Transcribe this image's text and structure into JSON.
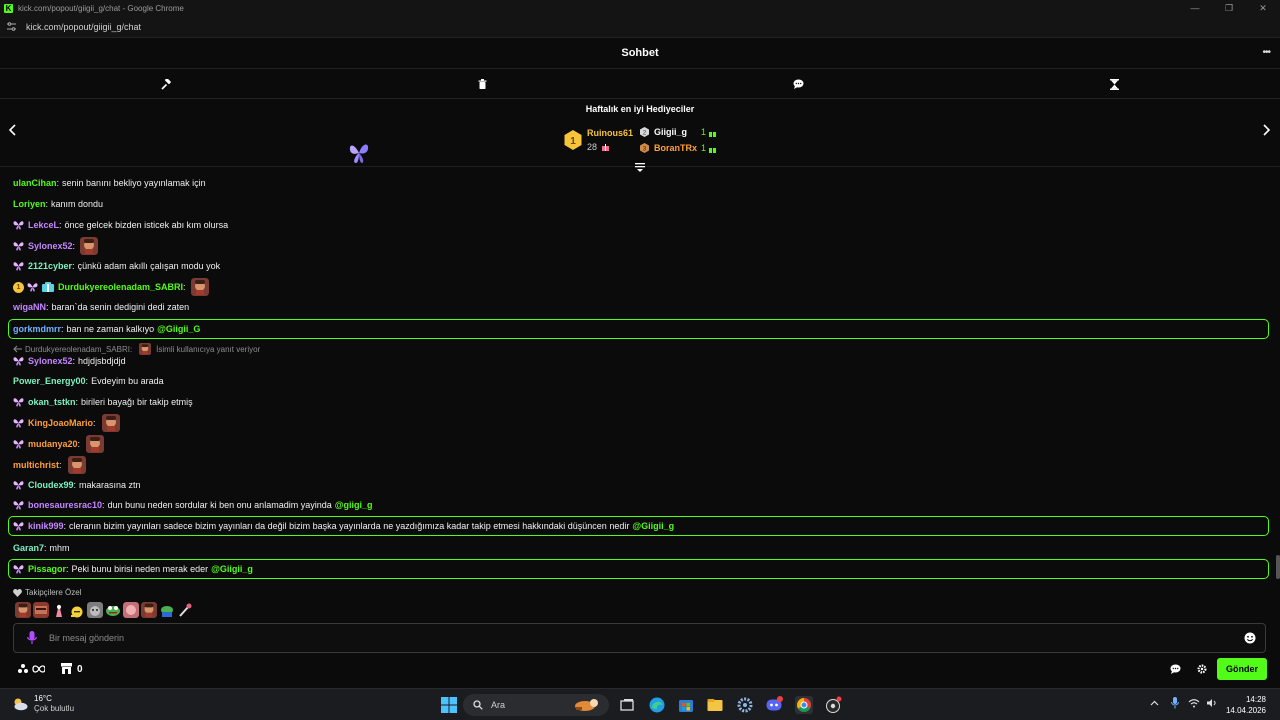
{
  "browser": {
    "window_title": "kick.com/popout/giigii_g/chat - Google Chrome",
    "url": "kick.com/popout/giigii_g/chat",
    "minimize": "—",
    "restore": "❐",
    "close": "✕"
  },
  "header": {
    "title": "Sohbet",
    "more": "•••"
  },
  "gifters": {
    "title": "Haftalık en iyi Hediyeciler",
    "rank1": {
      "name": "Ruinous61",
      "count": "28",
      "badge": "1"
    },
    "rank2": {
      "name": "Giigii_g",
      "count": "1"
    },
    "rank3": {
      "name": "BoranTRx",
      "count": "1"
    }
  },
  "messages": [
    {
      "user": "ulanCihan",
      "text": "senin banını bekliyo yayınlamak için"
    },
    {
      "user": "Loriyen",
      "text": "kanım dondu"
    },
    {
      "user": "LekceL",
      "text": "önce gelcek bizden isticek abı kım olursa"
    },
    {
      "user": "Sylonex52",
      "text": ""
    },
    {
      "user": "2121cyber",
      "text": "çünkü adam akıllı çalışan modu yok"
    },
    {
      "user": "Durdukyereolenadam_SABRI",
      "text": "",
      "badge": "1"
    },
    {
      "user": "wigaNN",
      "text": "baran`da senin dedigini dedi zaten"
    },
    {
      "user": "gorkmdmrr",
      "text": "ban ne zaman kalkıyo",
      "mention": "@Giigii_G"
    },
    {
      "user": "Sylonex52",
      "text": "hdjdjsbdjdjd"
    },
    {
      "user": "Power_Energy00",
      "text": "Evdeyim bu arada"
    },
    {
      "user": "okan_tstkn",
      "text": "birileri bayağı bir takip etmiş"
    },
    {
      "user": "KingJoaoMario",
      "text": ""
    },
    {
      "user": "mudanya20",
      "text": ""
    },
    {
      "user": "multichrist",
      "text": ""
    },
    {
      "user": "Cloudex99",
      "text": "makarasına ztn"
    },
    {
      "user": "bonesauresrac10",
      "text": "dun bunu neden sordular ki ben onu anlamadim yayinda",
      "mention": "@giigi_g"
    },
    {
      "user": "kinik999",
      "text": "cleranın bizim yayınları sadece bizim yayınları da değil bizim başka yayınlarda ne yazdığımıza kadar takip etmesi hakkındaki düşüncen nedir",
      "mention": "@Giigii_g"
    },
    {
      "user": "Garan7",
      "text": "mhm"
    },
    {
      "user": "Pissagor",
      "text": "Peki bunu birisi neden merak eder",
      "mention": "@Giigii_g"
    }
  ],
  "reply": {
    "to": "Durdukyereolenadam_SABRI:",
    "note": "İsimli kullanıcıya yanıt veriyor"
  },
  "followers_only": "Takipçilere Özel",
  "input": {
    "placeholder": "Bir mesaj gönderin"
  },
  "bottom": {
    "points": "0",
    "send_label": "Gönder"
  },
  "taskbar": {
    "weather_temp": "16°C",
    "weather_desc": "Çok bulutlu",
    "search_placeholder": "Ara",
    "time": "14:28",
    "date": "14.04.2026"
  },
  "colors": {
    "accent": "#53fc18",
    "user_green": "#53fc18",
    "user_mint": "#7cf3c2",
    "user_purple": "#c585ff",
    "user_orange": "#ff9f3a",
    "user_blue": "#6fb3ff",
    "gold": "#f7c33b"
  }
}
